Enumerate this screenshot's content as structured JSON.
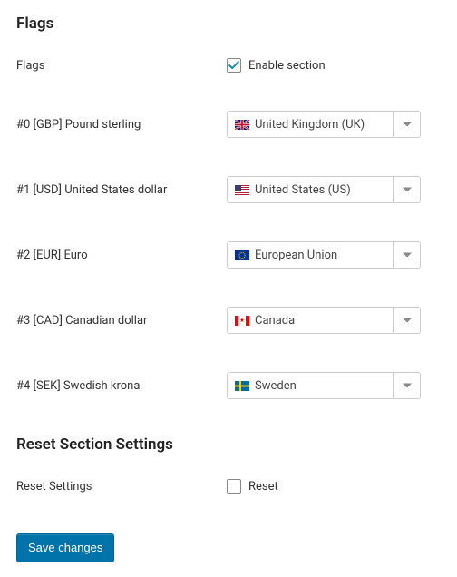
{
  "section_flags": {
    "heading": "Flags",
    "enable_label": "Flags",
    "enable_checkbox_text": "Enable section",
    "enable_checked": true,
    "rows": [
      {
        "label": "#0 [GBP] Pound sterling",
        "value": "United Kingdom (UK)",
        "flag": "uk"
      },
      {
        "label": "#1 [USD] United States dollar",
        "value": "United States (US)",
        "flag": "us"
      },
      {
        "label": "#2 [EUR] Euro",
        "value": "European Union",
        "flag": "eu"
      },
      {
        "label": "#3 [CAD] Canadian dollar",
        "value": "Canada",
        "flag": "ca"
      },
      {
        "label": "#4 [SEK] Swedish krona",
        "value": "Sweden",
        "flag": "se"
      }
    ]
  },
  "section_reset": {
    "heading": "Reset Section Settings",
    "label": "Reset Settings",
    "checkbox_text": "Reset",
    "checked": false
  },
  "save_button": "Save changes",
  "colors": {
    "accent": "#0073aa",
    "check": "#1e8cbe"
  }
}
